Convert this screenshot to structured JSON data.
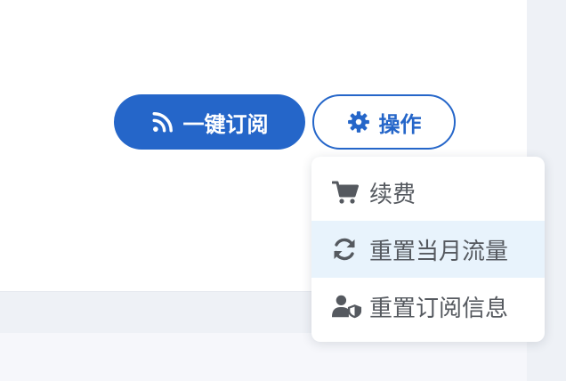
{
  "actions": {
    "subscribe_label": "一键订阅",
    "operate_label": "操作"
  },
  "menu": {
    "items": [
      {
        "label": "续费",
        "icon": "cart-icon"
      },
      {
        "label": "重置当月流量",
        "icon": "sync-icon"
      },
      {
        "label": "重置订阅信息",
        "icon": "user-shield-icon"
      }
    ],
    "highlighted_index": 1
  },
  "colors": {
    "primary": "#2566c9",
    "menu_hover": "#e8f3fc",
    "menu_text": "#55595f"
  }
}
